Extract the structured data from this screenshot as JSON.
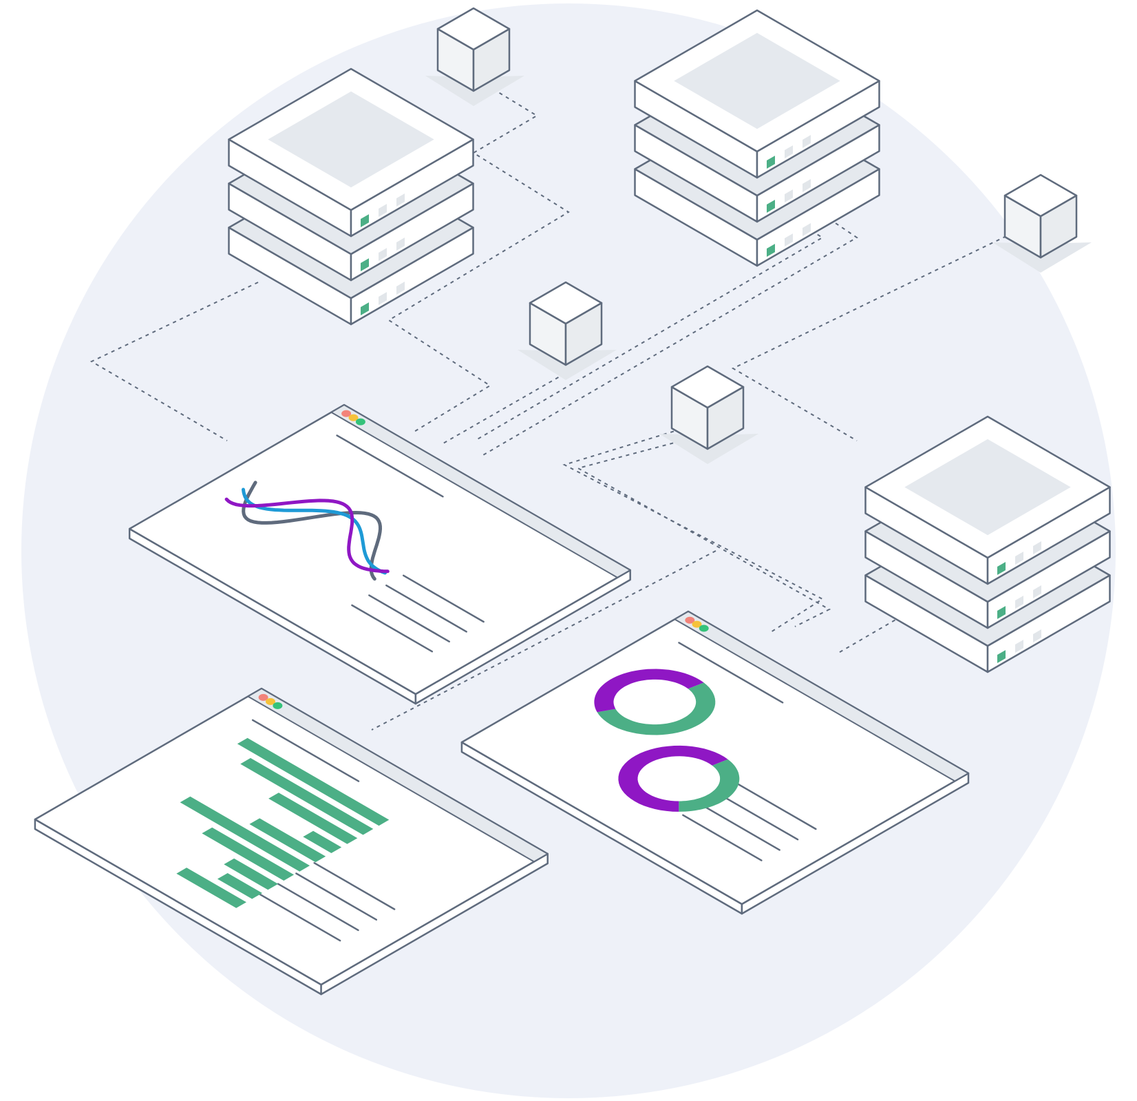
{
  "colors": {
    "background": "#ffffff",
    "backdrop": "#eef1f8",
    "outline": "#5f6b7d",
    "panel": "#ffffff",
    "inset": "#e5e9ee",
    "shadow": "#e3e7ec",
    "connector": "#5f6b7d",
    "green": "#4caf86",
    "purple": "#8f17c4",
    "blue": "#1e9ad6",
    "slate": "#5f6b7d",
    "dot_red": "#f2837a",
    "dot_yellow": "#f5c23b",
    "dot_green": "#35c27a",
    "led_off": "#e2e6ea"
  },
  "icons": {
    "server": "server-stack-icon",
    "block": "cube-icon",
    "window": "browser-window-icon"
  },
  "charts": {
    "bars": [
      0.9,
      0.78,
      0.5,
      0.18,
      0.42,
      0.76,
      0.52,
      0.28,
      0.22,
      0.38
    ],
    "donuts": [
      {
        "segments": [
          {
            "color": "green",
            "fraction": 0.55
          },
          {
            "color": "purple",
            "fraction": 0.45
          }
        ]
      },
      {
        "segments": [
          {
            "color": "green",
            "fraction": 0.35
          },
          {
            "color": "purple",
            "fraction": 0.65
          }
        ]
      }
    ],
    "waves": [
      "slate",
      "blue",
      "purple"
    ]
  }
}
